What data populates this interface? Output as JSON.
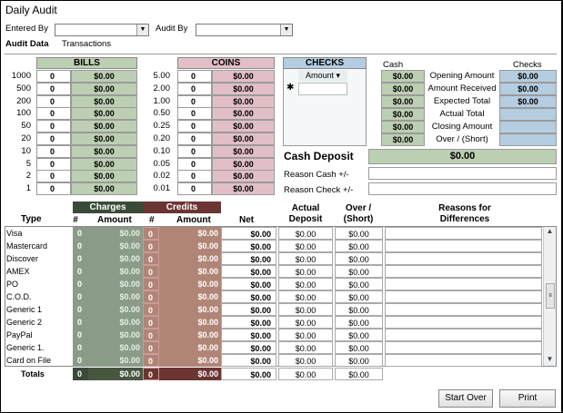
{
  "title": "Daily Audit",
  "entered_by": {
    "label": "Entered By",
    "value": ""
  },
  "audit_by": {
    "label": "Audit By",
    "value": ""
  },
  "tabs": [
    "Audit Data",
    "Transactions"
  ],
  "bills": {
    "title": "BILLS",
    "rows": [
      {
        "denom": "1000",
        "qty": "0",
        "amount": "$0.00"
      },
      {
        "denom": "500",
        "qty": "0",
        "amount": "$0.00"
      },
      {
        "denom": "200",
        "qty": "0",
        "amount": "$0.00"
      },
      {
        "denom": "100",
        "qty": "0",
        "amount": "$0.00"
      },
      {
        "denom": "50",
        "qty": "0",
        "amount": "$0.00"
      },
      {
        "denom": "20",
        "qty": "0",
        "amount": "$0.00"
      },
      {
        "denom": "10",
        "qty": "0",
        "amount": "$0.00"
      },
      {
        "denom": "5",
        "qty": "0",
        "amount": "$0.00"
      },
      {
        "denom": "2",
        "qty": "0",
        "amount": "$0.00"
      },
      {
        "denom": "1",
        "qty": "0",
        "amount": "$0.00"
      }
    ]
  },
  "coins": {
    "title": "COINS",
    "rows": [
      {
        "denom": "5.00",
        "qty": "0",
        "amount": "$0.00"
      },
      {
        "denom": "2.00",
        "qty": "0",
        "amount": "$0.00"
      },
      {
        "denom": "1.00",
        "qty": "0",
        "amount": "$0.00"
      },
      {
        "denom": "0.50",
        "qty": "0",
        "amount": "$0.00"
      },
      {
        "denom": "0.25",
        "qty": "0",
        "amount": "$0.00"
      },
      {
        "denom": "0.20",
        "qty": "0",
        "amount": "$0.00"
      },
      {
        "denom": "0.10",
        "qty": "0",
        "amount": "$0.00"
      },
      {
        "denom": "0.05",
        "qty": "0",
        "amount": "$0.00"
      },
      {
        "denom": "0.02",
        "qty": "0",
        "amount": "$0.00"
      },
      {
        "denom": "0.01",
        "qty": "0",
        "amount": "$0.00"
      }
    ]
  },
  "checks": {
    "title": "CHECKS",
    "column": "Amount",
    "new_row_marker": "✱"
  },
  "summary": {
    "cash_header": "Cash",
    "checks_header": "Checks",
    "rows": [
      {
        "label": "Opening Amount",
        "cash": "$0.00",
        "checks": "$0.00"
      },
      {
        "label": "Amount Received",
        "cash": "$0.00",
        "checks": "$0.00"
      },
      {
        "label": "Expected Total",
        "cash": "$0.00",
        "checks": "$0.00"
      },
      {
        "label": "Actual Total",
        "cash": "$0.00",
        "checks": ""
      },
      {
        "label": "Closing Amount",
        "cash": "$0.00",
        "checks": ""
      },
      {
        "label": "Over / (Short)",
        "cash": "$0.00",
        "checks": ""
      }
    ]
  },
  "cash_deposit": {
    "label": "Cash Deposit",
    "value": "$0.00"
  },
  "reason_cash": {
    "label": "Reason Cash +/-",
    "value": ""
  },
  "reason_check": {
    "label": "Reason Check +/-",
    "value": ""
  },
  "payments": {
    "headers": {
      "type": "Type",
      "charges": "Charges",
      "credits": "Credits",
      "count": "#",
      "amount": "Amount",
      "net": "Net",
      "actual": "Actual Deposit",
      "over": "Over / (Short)",
      "reasons": "Reasons for Differences"
    },
    "rows": [
      {
        "type": "Visa",
        "ch_n": "0",
        "ch_amt": "$0.00",
        "cr_n": "0",
        "cr_amt": "$0.00",
        "net": "$0.00",
        "actual": "$0.00",
        "over": "$0.00"
      },
      {
        "type": "Mastercard",
        "ch_n": "0",
        "ch_amt": "$0.00",
        "cr_n": "0",
        "cr_amt": "$0.00",
        "net": "$0.00",
        "actual": "$0.00",
        "over": "$0.00"
      },
      {
        "type": "Discover",
        "ch_n": "0",
        "ch_amt": "$0.00",
        "cr_n": "0",
        "cr_amt": "$0.00",
        "net": "$0.00",
        "actual": "$0.00",
        "over": "$0.00"
      },
      {
        "type": "AMEX",
        "ch_n": "0",
        "ch_amt": "$0.00",
        "cr_n": "0",
        "cr_amt": "$0.00",
        "net": "$0.00",
        "actual": "$0.00",
        "over": "$0.00"
      },
      {
        "type": "PO",
        "ch_n": "0",
        "ch_amt": "$0.00",
        "cr_n": "0",
        "cr_amt": "$0.00",
        "net": "$0.00",
        "actual": "$0.00",
        "over": "$0.00"
      },
      {
        "type": "C.O.D.",
        "ch_n": "0",
        "ch_amt": "$0.00",
        "cr_n": "0",
        "cr_amt": "$0.00",
        "net": "$0.00",
        "actual": "$0.00",
        "over": "$0.00"
      },
      {
        "type": "Generic 1",
        "ch_n": "0",
        "ch_amt": "$0.00",
        "cr_n": "0",
        "cr_amt": "$0.00",
        "net": "$0.00",
        "actual": "$0.00",
        "over": "$0.00"
      },
      {
        "type": "Generic 2",
        "ch_n": "0",
        "ch_amt": "$0.00",
        "cr_n": "0",
        "cr_amt": "$0.00",
        "net": "$0.00",
        "actual": "$0.00",
        "over": "$0.00"
      },
      {
        "type": "PayPal",
        "ch_n": "0",
        "ch_amt": "$0.00",
        "cr_n": "0",
        "cr_amt": "$0.00",
        "net": "$0.00",
        "actual": "$0.00",
        "over": "$0.00"
      },
      {
        "type": "Generic 1.",
        "ch_n": "0",
        "ch_amt": "$0.00",
        "cr_n": "0",
        "cr_amt": "$0.00",
        "net": "$0.00",
        "actual": "$0.00",
        "over": "$0.00"
      },
      {
        "type": "Card on File",
        "ch_n": "0",
        "ch_amt": "$0.00",
        "cr_n": "0",
        "cr_amt": "$0.00",
        "net": "$0.00",
        "actual": "$0.00",
        "over": "$0.00"
      }
    ],
    "totals": {
      "label": "Totals",
      "ch_n": "0",
      "ch_amt": "$0.00",
      "cr_n": "0",
      "cr_amt": "$0.00",
      "net": "$0.00",
      "actual": "$0.00",
      "over": "$0.00"
    }
  },
  "buttons": {
    "start_over": "Start Over",
    "print": "Print"
  },
  "colors": {
    "bills": "#bccfb2",
    "coins": "#e2bfc6",
    "checks": "#b4cde0",
    "charges_dark": "#3a4a38",
    "credits_dark": "#6b3534"
  }
}
